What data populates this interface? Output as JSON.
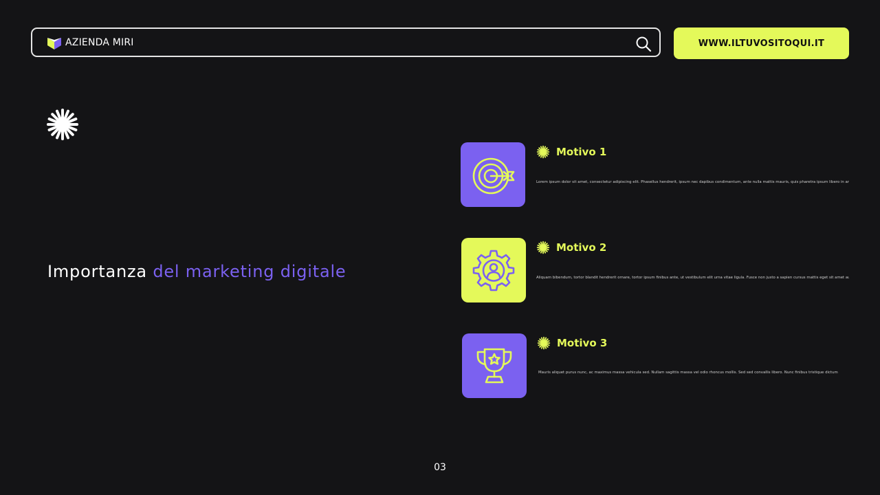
{
  "header": {
    "brand_name": "AZIENDA MIRI",
    "website_button_label": "WWW.ILTUVOSITOQUI.IT"
  },
  "slide": {
    "title_part1": "Importanza",
    "title_part2": "del marketing digitale",
    "page_number": "03"
  },
  "motivi": [
    {
      "title": "Motivo 1",
      "description": "Lorem ipsum dolor sit amet, consectetur adipiscing elit. Phasellus hendrerit, ipsum nec dapibus condimentum, ante nulla mattis mauris, quis pharetra ipsum libero in ante",
      "icon": "target-icon"
    },
    {
      "title": "Motivo 2",
      "description": "Aliquam bibendum, tortor blandit hendrerit ornare, tortor ipsum finibus ante, ut vestibulum elit urna vitae ligula. Fusce non justo a sapien cursus mattis eget sit amet augue",
      "icon": "gear-user-icon"
    },
    {
      "title": "Motivo 3",
      "description": "Mauris aliquet purus nunc, ac maximus massa vehicula sed. Nullam sagittis massa vel odio rhoncus mollis. Sed sed convallis libero. Nunc finibus tristique dictum",
      "icon": "trophy-icon"
    }
  ],
  "colors": {
    "background": "#141416",
    "accent_yellow": "#e4f95a",
    "accent_purple": "#7b61f0"
  }
}
